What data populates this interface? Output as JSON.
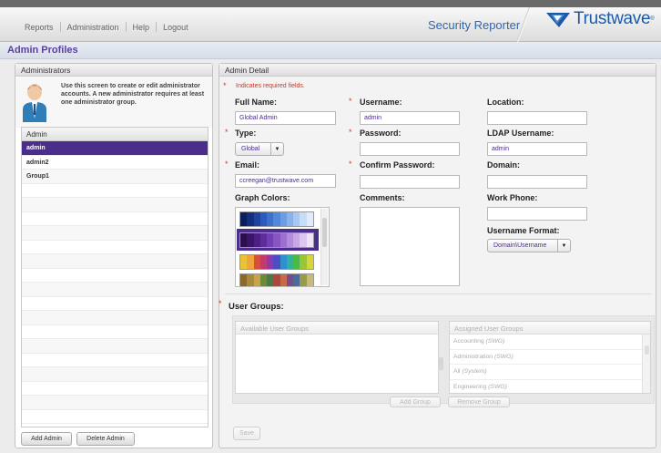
{
  "nav": {
    "items": [
      "Reports",
      "Administration",
      "Help",
      "Logout"
    ]
  },
  "brand": {
    "product": "Security Reporter",
    "logo_text": "Trustwave",
    "logo_mark": "®"
  },
  "page_title": "Admin Profiles",
  "administrators": {
    "header": "Administrators",
    "intro_text": "Use this screen to create or edit administrator accounts. A new administrator requires at least one administrator group.",
    "list_header": "Admin",
    "rows": [
      "admin",
      "admin2",
      "Group1"
    ],
    "selected_index": 0,
    "add_button": "Add Admin",
    "delete_button": "Delete Admin"
  },
  "detail": {
    "header": "Admin Detail",
    "required_note": "Indicates required fields.",
    "required_marker": "*",
    "full_name_label": "Full Name:",
    "full_name_value": "Global Admin",
    "username_label": "Username:",
    "username_value": "admin",
    "location_label": "Location:",
    "location_value": "",
    "type_label": "Type:",
    "type_value": "Global",
    "password_label": "Password:",
    "ldap_label": "LDAP Username:",
    "ldap_value": "admin",
    "email_label": "Email:",
    "email_value": "ccreegan@trustwave.com",
    "confirm_label": "Confirm Password:",
    "domain_label": "Domain:",
    "graph_colors_label": "Graph Colors:",
    "comments_label": "Comments:",
    "work_phone_label": "Work Phone:",
    "username_format_label": "Username Format:",
    "username_format_value": "Domain\\Username",
    "user_groups_label": "User Groups:",
    "available_groups_header": "Available User Groups",
    "assigned_groups_header": "Assigned User Groups",
    "assigned_groups": [
      {
        "name": "Accounting",
        "tag": "(SWG)"
      },
      {
        "name": "Administration",
        "tag": "(SWG)"
      },
      {
        "name": "All",
        "tag": "(System)"
      },
      {
        "name": "Engineering",
        "tag": "(SWG)"
      }
    ],
    "add_group_button": "Add Group",
    "remove_group_button": "Remove Group",
    "save_button": "Save"
  },
  "colors": {
    "accent": "#4b2d8c",
    "brand_blue": "#1c5aa8",
    "required": "#d23b2a"
  },
  "icons": [
    "admin-user-icon",
    "dropdown-arrow-icon",
    "trustwave-logo-icon"
  ]
}
